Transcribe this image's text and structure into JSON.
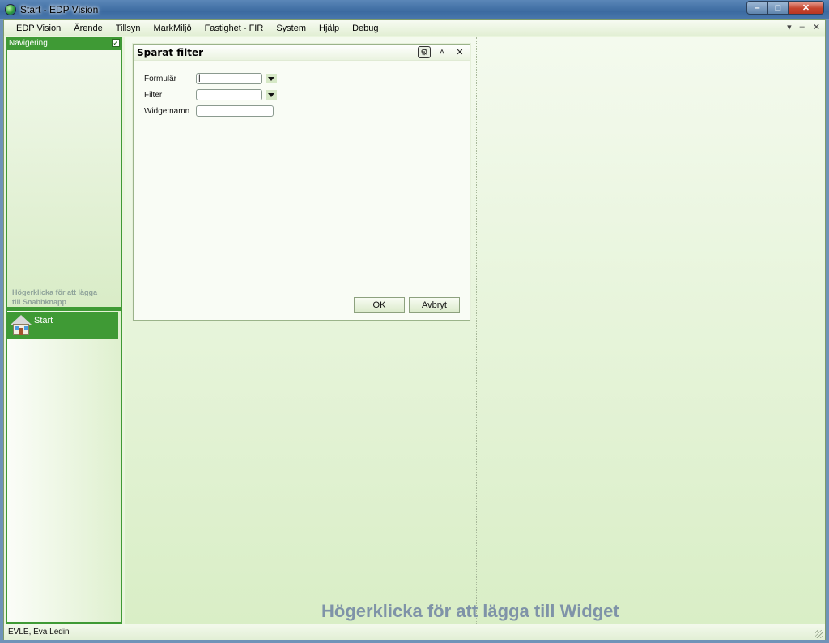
{
  "window": {
    "title": "Start - EDP Vision",
    "min_icon": "–",
    "max_icon": "□",
    "close_icon": "✕"
  },
  "menubar": {
    "items": [
      "EDP Vision",
      "Ärende",
      "Tillsyn",
      "MarkMiljö",
      "Fastighet - FIR",
      "System",
      "Hjälp",
      "Debug"
    ],
    "mdi_dropdown": "▾",
    "mdi_minimize": "–",
    "mdi_close": "✕"
  },
  "navigation": {
    "header": "Navigering",
    "checked": "✓",
    "hint": "Högerklicka för att lägga till Snabbknapp",
    "quick_buttons": [
      {
        "label": "Start",
        "icon": "house-icon"
      }
    ]
  },
  "widget": {
    "title": "Sparat filter",
    "collapse_icon": "˄",
    "close_icon": "✕",
    "gear_icon": "⚙",
    "fields": {
      "formular": {
        "label": "Formulär",
        "value": "|"
      },
      "filter": {
        "label": "Filter",
        "value": ""
      },
      "widgetnamn": {
        "label": "Widgetnamn",
        "value": ""
      }
    },
    "ok_label": "OK",
    "cancel_label": "Avbryt"
  },
  "workspace": {
    "hint": "Högerklicka för att lägga till Widget"
  },
  "statusbar": {
    "user": "EVLE, Eva Ledin"
  },
  "colors": {
    "accent_green": "#3f9a35",
    "hint_gray": "#7f93a8"
  }
}
